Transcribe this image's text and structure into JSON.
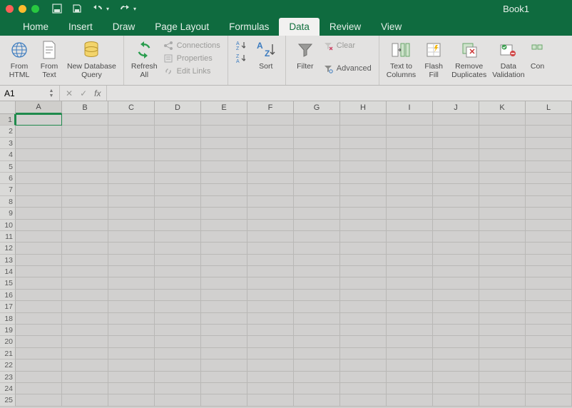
{
  "title": "Book1",
  "tabs": [
    "Home",
    "Insert",
    "Draw",
    "Page Layout",
    "Formulas",
    "Data",
    "Review",
    "View"
  ],
  "active_tab": "Data",
  "ribbon": {
    "from_html": "From\nHTML",
    "from_text": "From\nText",
    "new_db_query": "New Database\nQuery",
    "refresh_all": "Refresh\nAll",
    "connections": "Connections",
    "properties": "Properties",
    "edit_links": "Edit Links",
    "sort": "Sort",
    "filter": "Filter",
    "clear": "Clear",
    "advanced": "Advanced",
    "text_to_columns": "Text to\nColumns",
    "flash_fill": "Flash\nFill",
    "remove_duplicates": "Remove\nDuplicates",
    "data_validation": "Data\nValidation",
    "consolidate": "Con"
  },
  "namebox": "A1",
  "columns": [
    "A",
    "B",
    "C",
    "D",
    "E",
    "F",
    "G",
    "H",
    "I",
    "J",
    "K",
    "L"
  ],
  "rows": [
    "1",
    "2",
    "3",
    "4",
    "5",
    "6",
    "7",
    "8",
    "9",
    "10",
    "11",
    "12",
    "13",
    "14",
    "15",
    "16",
    "17",
    "18",
    "19",
    "20",
    "21",
    "22",
    "23",
    "24",
    "25"
  ],
  "active_cell": {
    "col": 0,
    "row": 0
  }
}
